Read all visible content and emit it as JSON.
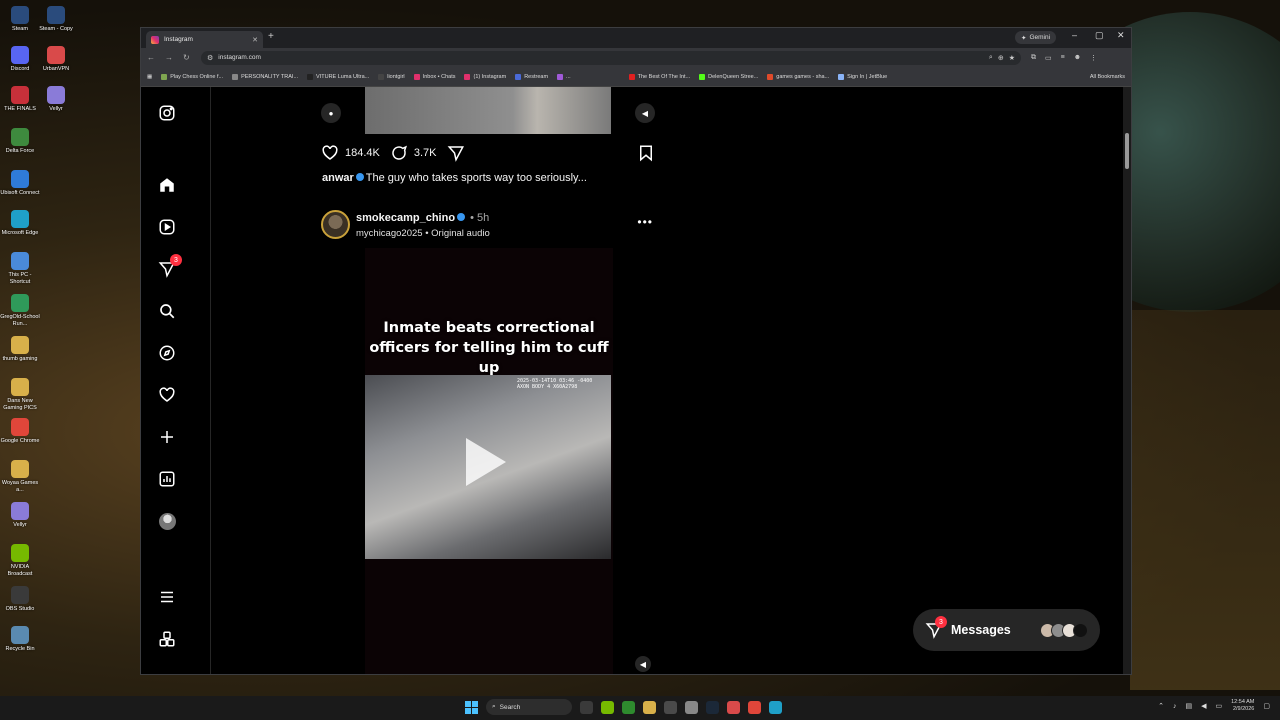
{
  "desktop": {
    "icons": [
      {
        "label": "Steam",
        "color": "#2a4b7c"
      },
      {
        "label": "Steam - Copy",
        "color": "#2a4b7c"
      },
      {
        "label": "Discord",
        "color": "#5865f2"
      },
      {
        "label": "UrbanVPN",
        "color": "#d94a4a"
      },
      {
        "label": "THE FINALS",
        "color": "#c8303a"
      },
      {
        "label": "Vellyr",
        "color": "#8a7bd8"
      },
      {
        "label": "Delta Force",
        "color": "#3e8a3e"
      },
      {
        "label": "Ubisoft Connect",
        "color": "#2f7bd8"
      },
      {
        "label": "Microsoft Edge",
        "color": "#1fa0c8"
      },
      {
        "label": "This PC - Shortcut",
        "color": "#4a8ad8"
      },
      {
        "label": "GregOld-School Run...",
        "color": "#2f9a5a"
      },
      {
        "label": "thumb gaming",
        "color": "#d8b04a"
      },
      {
        "label": "Dans New Gaming PICS",
        "color": "#d8b04a"
      },
      {
        "label": "Google Chrome",
        "color": "#e0463a"
      },
      {
        "label": "Woyaa Games a...",
        "color": "#d8b04a"
      },
      {
        "label": "Vellyr",
        "color": "#8a7bd8"
      },
      {
        "label": "NVIDIA Broadcast",
        "color": "#76b900"
      },
      {
        "label": "OBS Studio",
        "color": "#3a3a3a"
      },
      {
        "label": "Recycle Bin",
        "color": "#5a8ab0"
      }
    ]
  },
  "browser": {
    "tab_title": "Instagram",
    "tab_close": "✕",
    "new_tab": "+",
    "gemini_label": "Gemini",
    "window_controls": {
      "minimize": "–",
      "maximize": "▢",
      "close": "✕"
    },
    "url": "instagram.com",
    "bookmarks": [
      {
        "label": "Play Chess Online f...",
        "color": "#7fa650"
      },
      {
        "label": "PERSONALITY TRAI...",
        "color": "#888888"
      },
      {
        "label": "VITURE Luma Ultra...",
        "color": "#222222"
      },
      {
        "label": "liontgirl",
        "color": "#444444"
      },
      {
        "label": "Inbox • Chats",
        "color": "#e1306c"
      },
      {
        "label": "(1) Instagram",
        "color": "#e1306c"
      },
      {
        "label": "Restream",
        "color": "#4a6ad8"
      },
      {
        "label": "...",
        "color": "#a05ad8"
      },
      {
        "label": "The Best Of The Int...",
        "color": "#e02020"
      },
      {
        "label": "DelenQueen Stree...",
        "color": "#53fc18"
      },
      {
        "label": "games games - sha...",
        "color": "#e04a2a"
      },
      {
        "label": "Sign In | JetBlue",
        "color": "#8ab4f8"
      }
    ],
    "all_bookmarks": "All Bookmarks"
  },
  "instagram": {
    "nav_badge_count": "3",
    "prev_post": {
      "likes": "184.4K",
      "comments": "3.7K",
      "caption_user": "anwar",
      "caption_text": "The guy who takes sports way too seriously..."
    },
    "post": {
      "username": "smokecamp_chino",
      "time": "5h",
      "separator": "•",
      "audio_user": "mychicago2025",
      "audio_label": "Original audio",
      "overlay_text": "Inmate beats correctional officers for telling him to cuff up",
      "timestamp_overlay": "2025-03-14T10 03:46 -0400\nAXON BODY 4 X60A2798"
    },
    "messages": {
      "label": "Messages",
      "badge": "3"
    }
  },
  "taskbar": {
    "search_placeholder": "Search",
    "time": "12:54 AM",
    "date": "2/9/2026"
  }
}
